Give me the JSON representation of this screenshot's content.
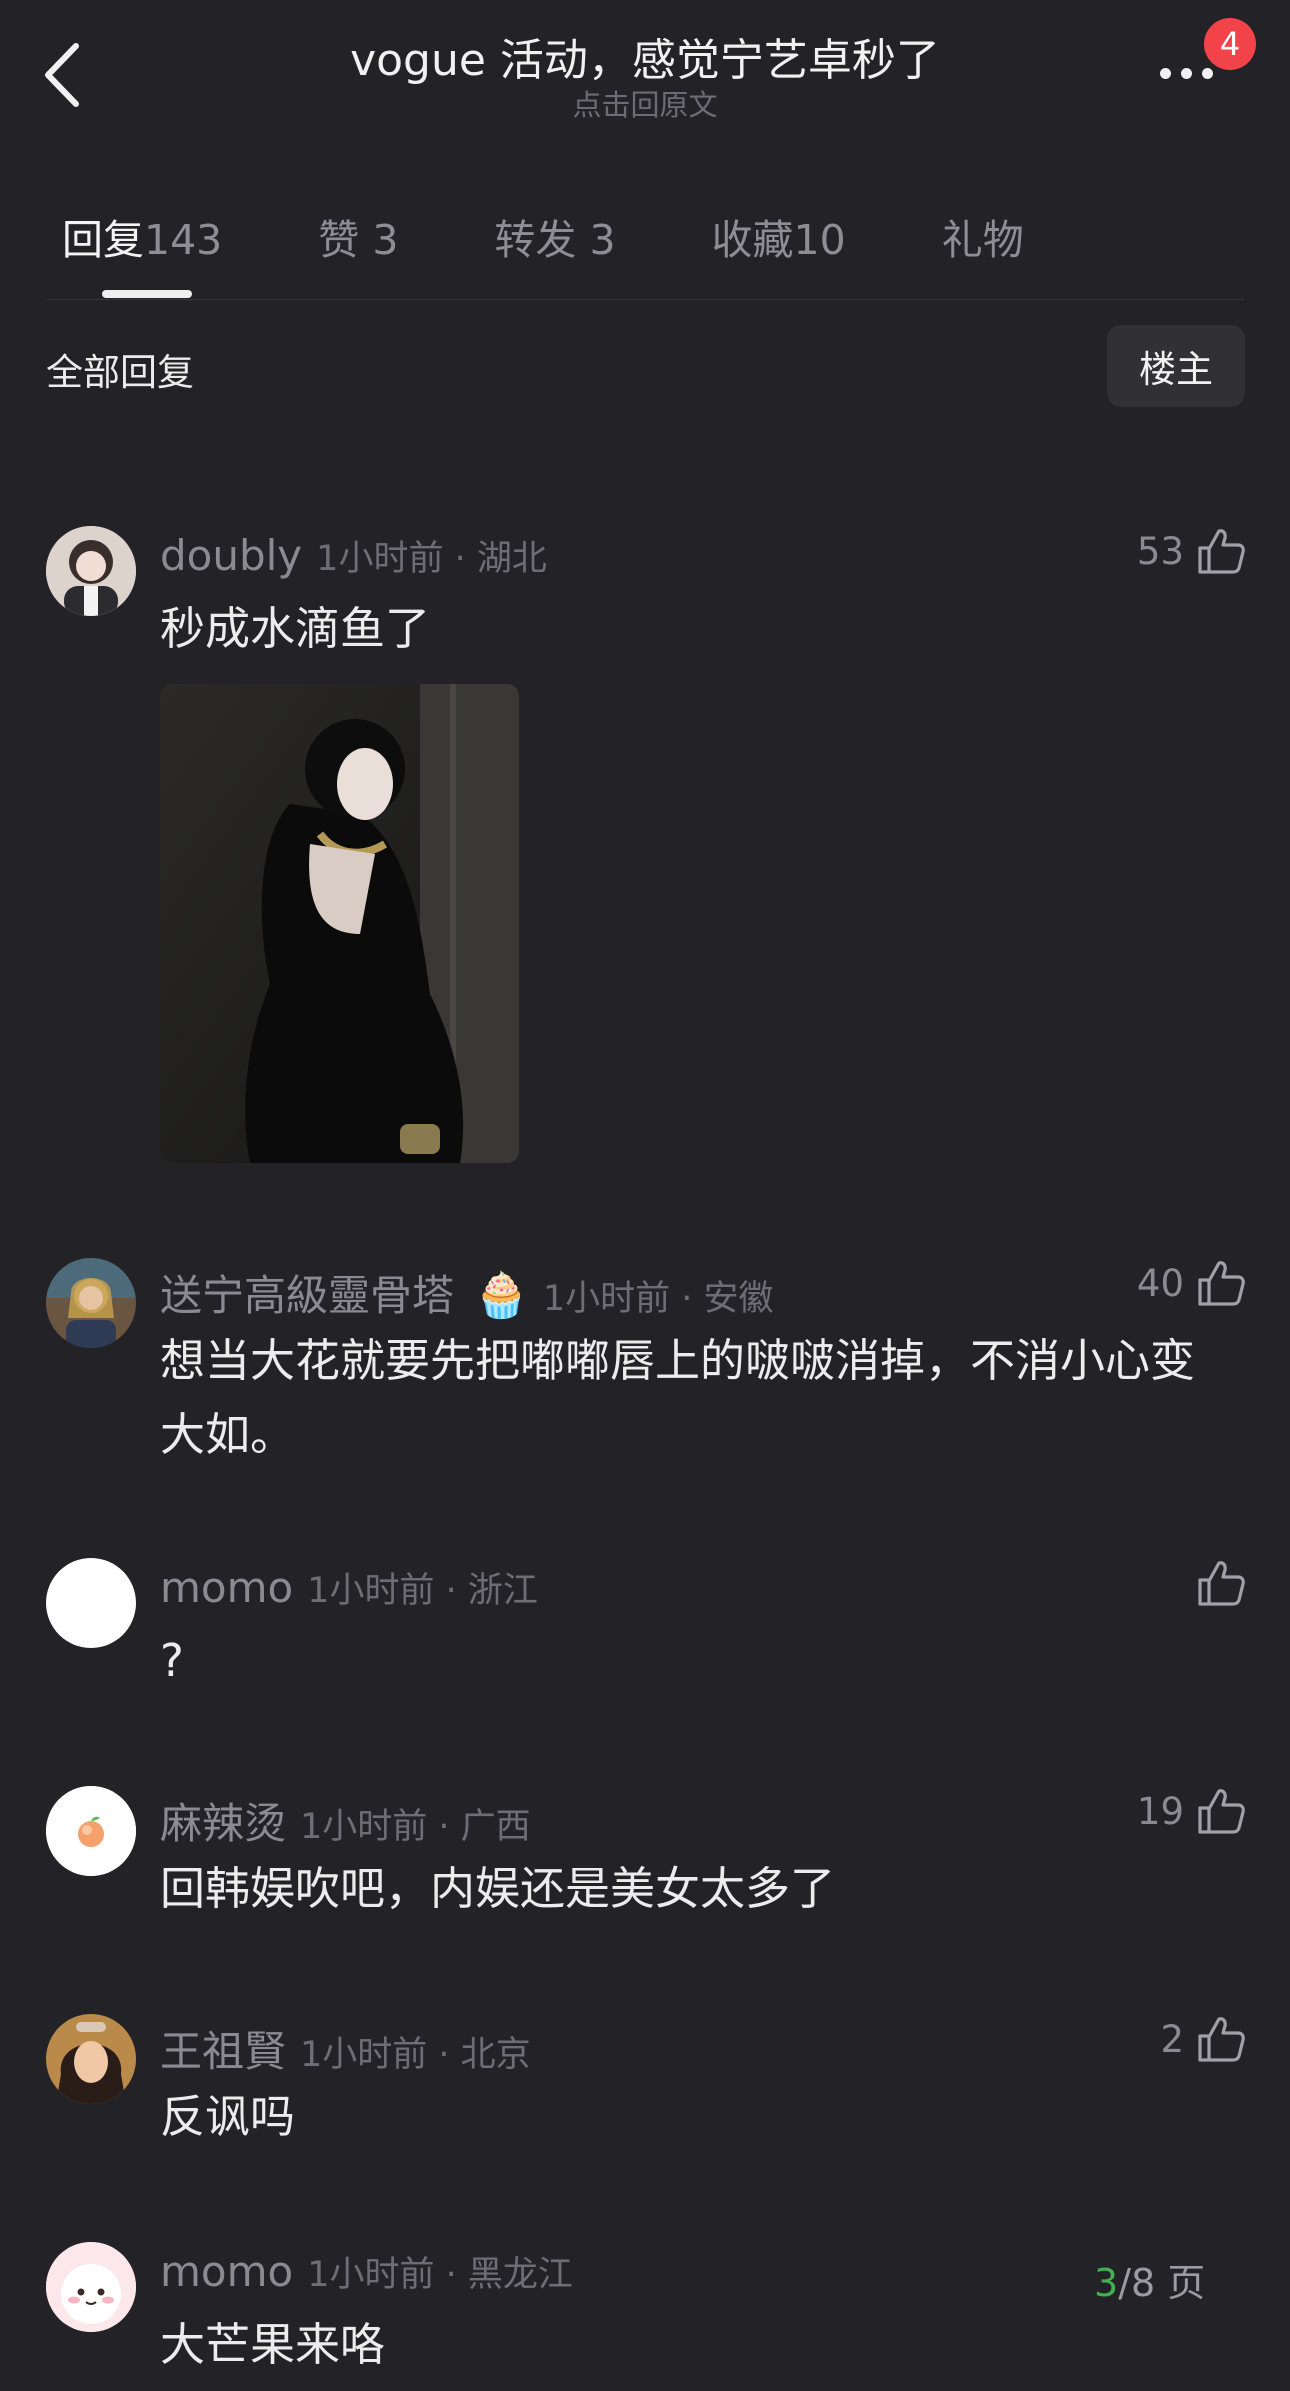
{
  "header": {
    "title": "vogue 活动，感觉宁艺卓秒了",
    "subtitle": "点击回原文",
    "badge": "4"
  },
  "tabs": [
    {
      "label": "回复",
      "count": "143"
    },
    {
      "label": "赞",
      "count": "3"
    },
    {
      "label": "转发",
      "count": "3"
    },
    {
      "label": "收藏",
      "count": "10"
    },
    {
      "label": "礼物",
      "count": ""
    }
  ],
  "filter": {
    "label": "全部回复",
    "owner_button": "楼主"
  },
  "comments": [
    {
      "name": "doubly",
      "meta": "1小时前 · 湖北",
      "likes": "53",
      "text": "秒成水滴鱼了"
    },
    {
      "name": "送宁高級靈骨塔",
      "emoji": "🧁",
      "meta": "1小时前 · 安徽",
      "likes": "40",
      "text": "想当大花就要先把嘟嘟唇上的啵啵消掉，不消小心变大如。"
    },
    {
      "name": "momo",
      "meta": "1小时前 · 浙江",
      "likes": "",
      "text": "?"
    },
    {
      "name": "麻辣烫",
      "meta": "1小时前 · 广西",
      "likes": "19",
      "text": "回韩娱吹吧，内娱还是美女太多了"
    },
    {
      "name": "王祖賢",
      "meta": "1小时前 · 北京",
      "likes": "2",
      "text": "反讽吗"
    },
    {
      "name": "momo",
      "meta": "1小时前 · 黑龙江",
      "likes": "",
      "text": "大芒果来咯"
    }
  ],
  "pager": {
    "current": "3",
    "total": "/8 页"
  },
  "colors": {
    "background": "#232327",
    "badge": "#f2434b",
    "pager_current": "#41b04f"
  }
}
